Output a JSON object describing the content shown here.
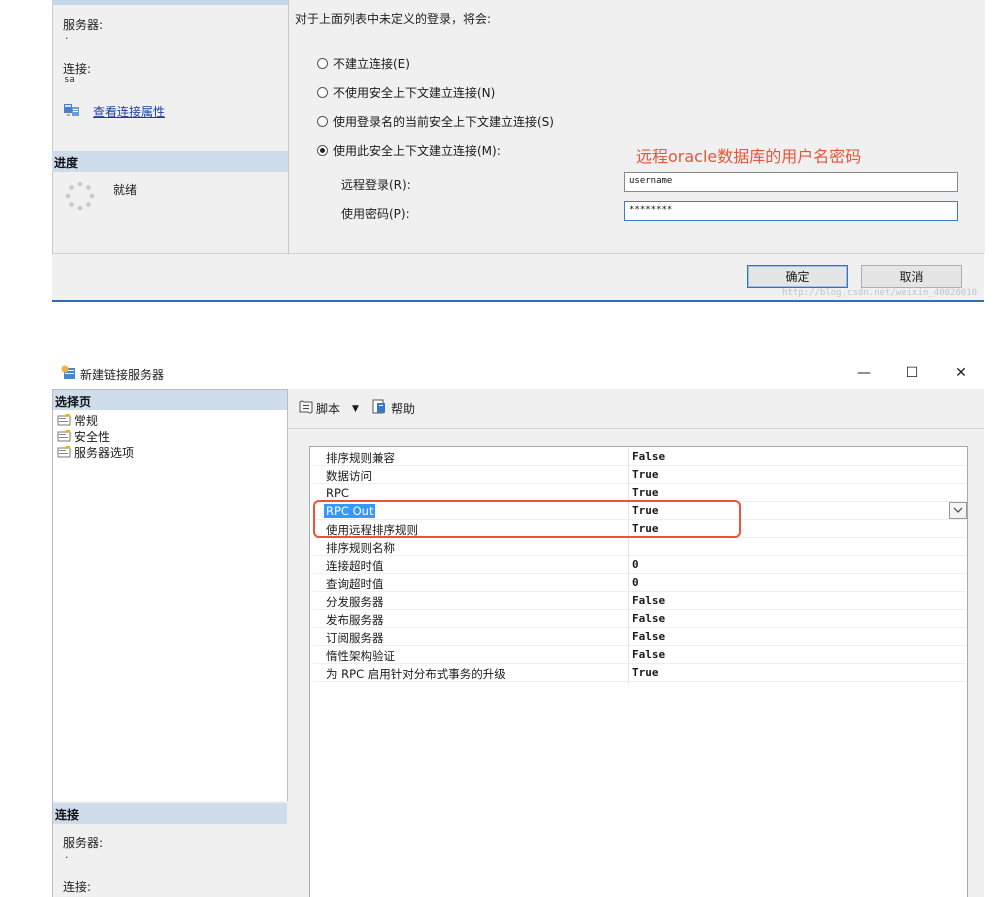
{
  "top_dialog": {
    "left_panel": {
      "server_label": "服务器:",
      "server_value": ".",
      "connection_label": "连接:",
      "connection_value": "sa",
      "view_conn_props_link": "查看连接属性",
      "progress_header": "进度",
      "progress_status": "就绪"
    },
    "security": {
      "intro_text": "对于上面列表中未定义的登录，将会:",
      "options": [
        {
          "label": "不建立连接(E)",
          "selected": false
        },
        {
          "label": "不使用安全上下文建立连接(N)",
          "selected": false
        },
        {
          "label": "使用登录名的当前安全上下文建立连接(S)",
          "selected": false
        },
        {
          "label": "使用此安全上下文建立连接(M):",
          "selected": true
        }
      ],
      "annotation": "远程oracle数据库的用户名密码",
      "remote_login_label": "远程登录(R):",
      "remote_login_value": "username",
      "password_label": "使用密码(P):",
      "password_value": "********"
    },
    "footer": {
      "ok_label": "确定",
      "cancel_label": "取消",
      "watermark": "http://blog.csdn.net/weixin_40026010"
    }
  },
  "window": {
    "title": "新建链接服务器",
    "controls": {
      "minimize": "—",
      "maximize": "☐",
      "close": "✕"
    },
    "nav": {
      "header": "选择页",
      "items": [
        {
          "label": "常规"
        },
        {
          "label": "安全性"
        },
        {
          "label": "服务器选项"
        }
      ]
    },
    "toolbar": {
      "script_label": "脚本",
      "help_label": "帮助"
    },
    "connection": {
      "header": "连接",
      "server_label": "服务器:",
      "server_value": ".",
      "connection_label": "连接:"
    },
    "options": [
      {
        "name": "排序规则兼容",
        "value": "False"
      },
      {
        "name": "数据访问",
        "value": "True"
      },
      {
        "name": "RPC",
        "value": "True"
      },
      {
        "name": "RPC Out",
        "value": "True",
        "selected": true
      },
      {
        "name": "使用远程排序规则",
        "value": "True"
      },
      {
        "name": "排序规则名称",
        "value": ""
      },
      {
        "name": "连接超时值",
        "value": "0"
      },
      {
        "name": "查询超时值",
        "value": "0"
      },
      {
        "name": "分发服务器",
        "value": "False"
      },
      {
        "name": "发布服务器",
        "value": "False"
      },
      {
        "name": "订阅服务器",
        "value": "False"
      },
      {
        "name": "惰性架构验证",
        "value": "False"
      },
      {
        "name": "为 RPC 启用针对分布式事务的升级",
        "value": "True"
      }
    ]
  },
  "colors": {
    "accent_blue": "#3399ff",
    "annotation_red": "#e8553a",
    "panel_header": "#cfdcec"
  }
}
